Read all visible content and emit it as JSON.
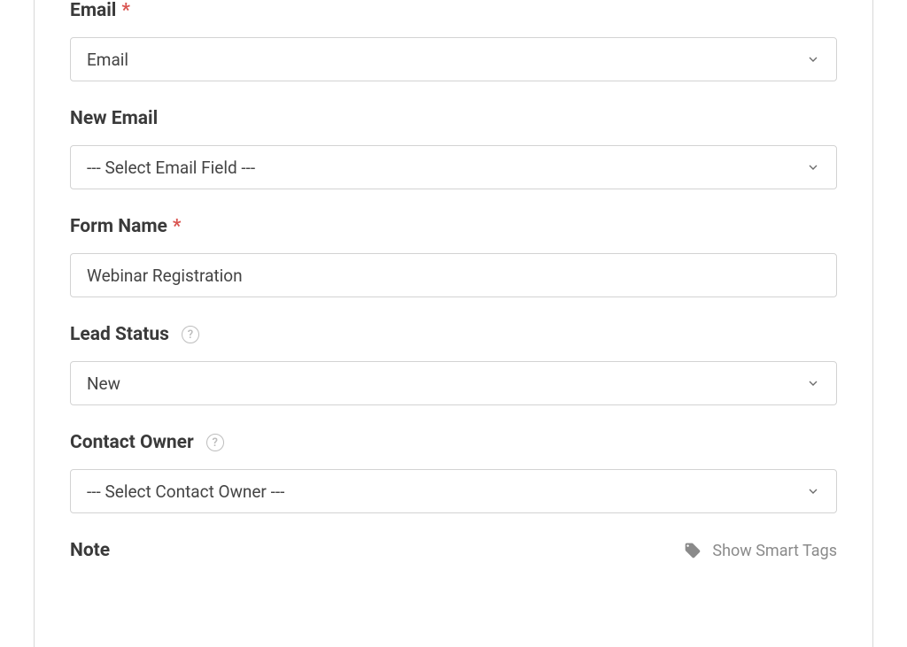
{
  "fields": {
    "email": {
      "label": "Email",
      "required": true,
      "value": "Email"
    },
    "new_email": {
      "label": "New Email",
      "required": false,
      "placeholder": "--- Select Email Field ---"
    },
    "form_name": {
      "label": "Form Name",
      "required": true,
      "value": "Webinar Registration"
    },
    "lead_status": {
      "label": "Lead Status",
      "required": false,
      "has_help": true,
      "value": "New"
    },
    "contact_owner": {
      "label": "Contact Owner",
      "required": false,
      "has_help": true,
      "placeholder": "--- Select Contact Owner ---"
    },
    "note": {
      "label": "Note",
      "smart_tags_label": "Show Smart Tags"
    }
  },
  "ui": {
    "required_mark": "*",
    "help_mark": "?"
  }
}
